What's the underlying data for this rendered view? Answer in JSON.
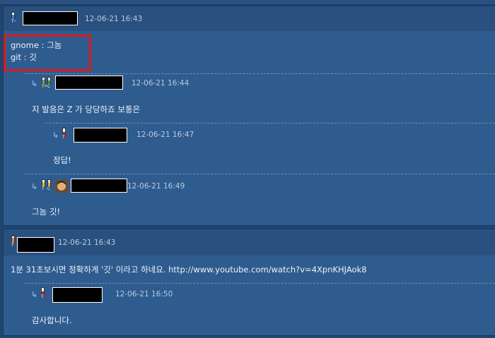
{
  "comments": [
    {
      "time": "12-06-21 16:43",
      "lines": [
        "gnome : 그놈",
        "git : 깃"
      ],
      "replies": [
        {
          "time": "12-06-21 16:44",
          "text": "지 발음은 Z 가 당당하죠 보통은"
        },
        {
          "time": "12-06-21 16:47",
          "text": "정답!"
        },
        {
          "time": "12-06-21 16:49",
          "text": "그놈 깃!"
        }
      ]
    },
    {
      "time": "12-06-21 16:43",
      "text": "1분 31초보시면 정확하게 '깃' 이라고 하네요. http://www.youtube.com/watch?v=4XpnKHJAok8",
      "replies": [
        {
          "time": "12-06-21 16:50",
          "text": "감사합니다."
        }
      ]
    }
  ],
  "colors": {
    "background": "#20456f",
    "panel": "#2f5c8f",
    "highlight": "#e0181b"
  },
  "icons": [
    "level-icon",
    "reply-arrow-icon",
    "avatar"
  ]
}
